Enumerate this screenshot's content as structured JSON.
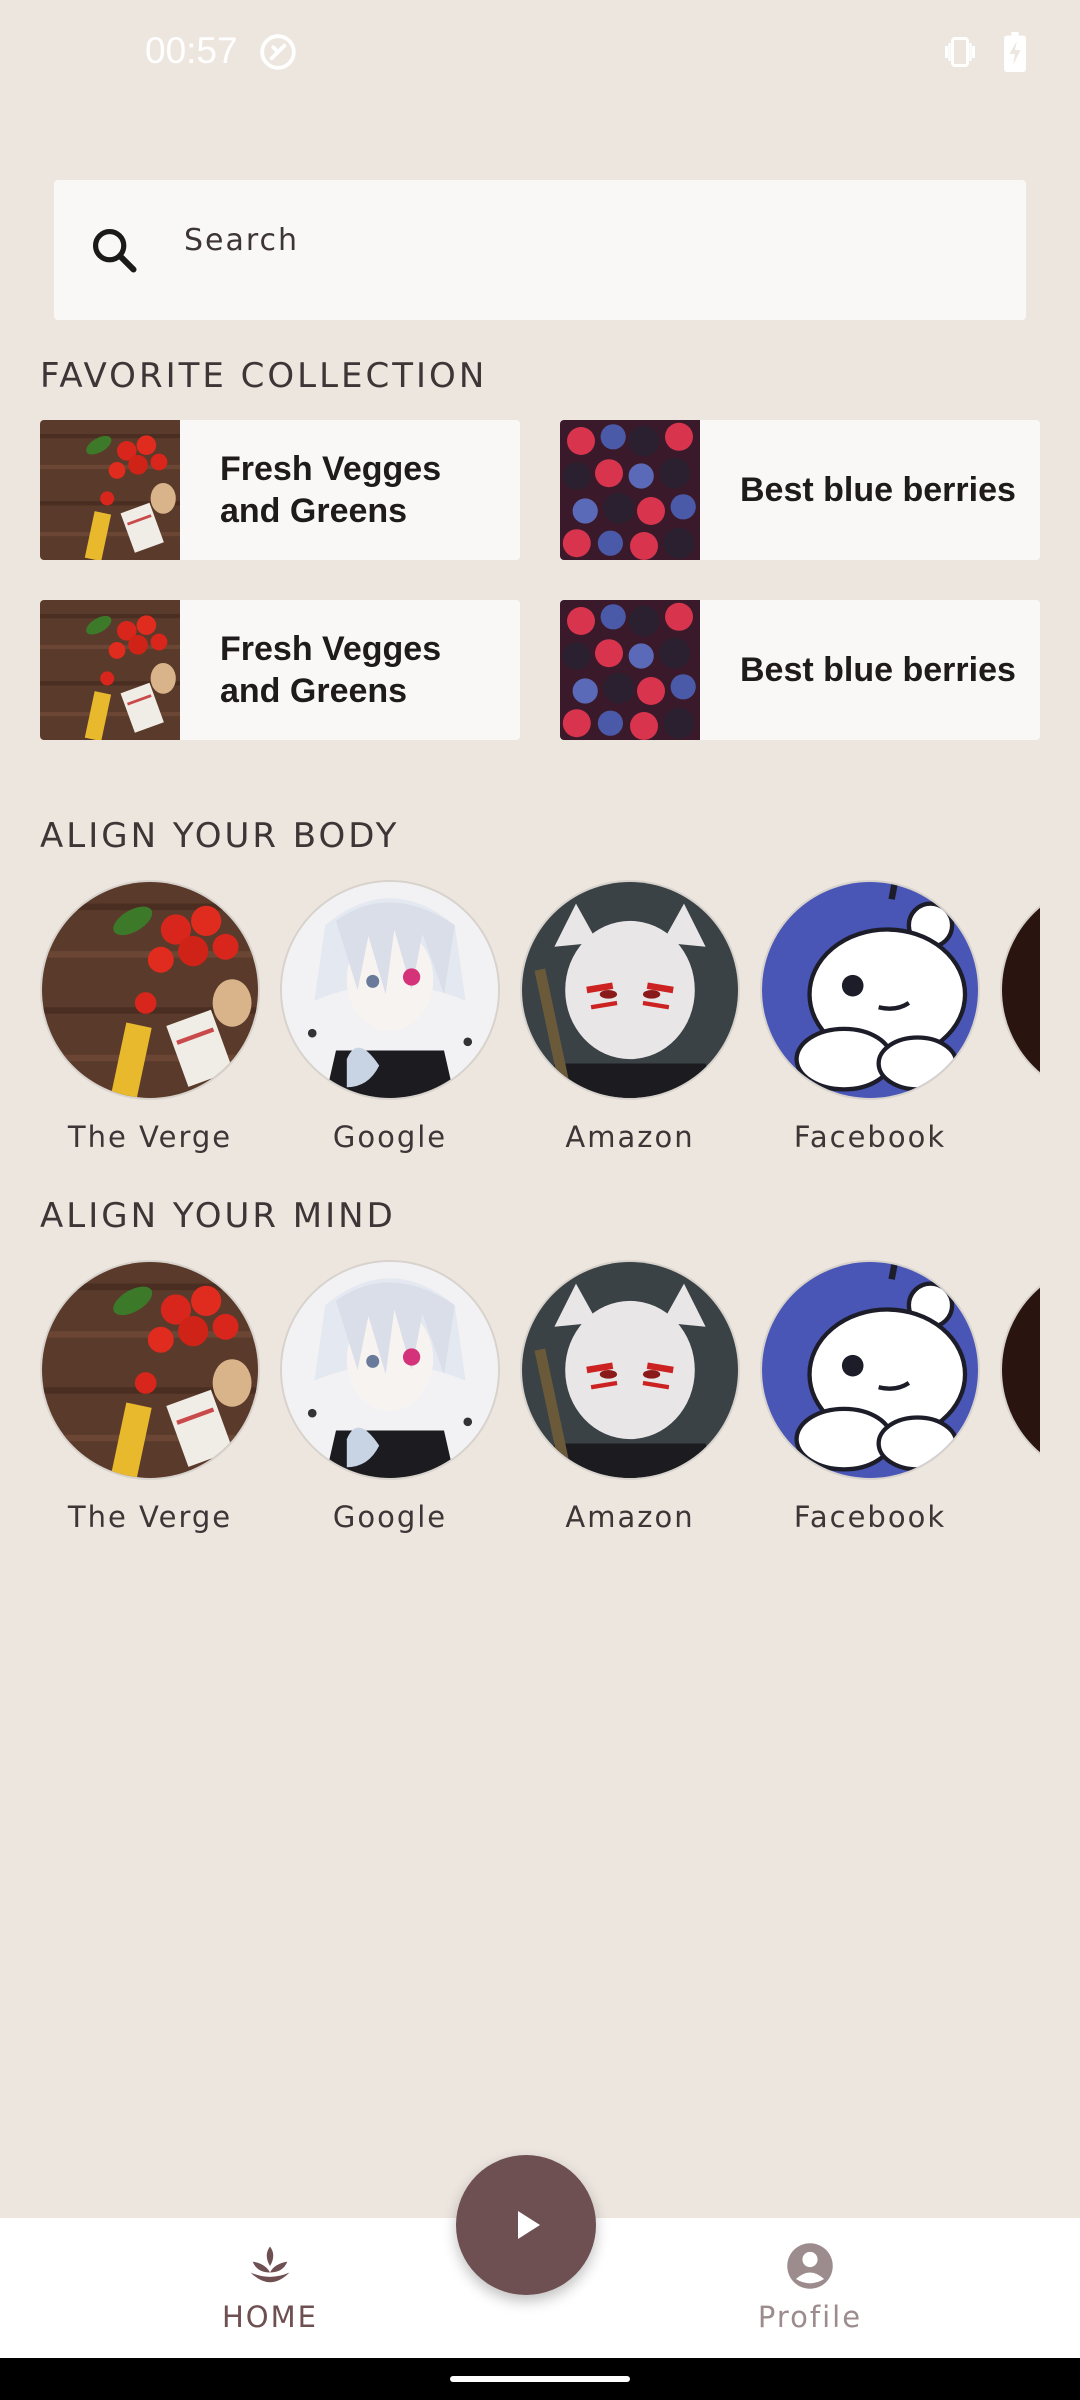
{
  "status_bar": {
    "time": "00:57"
  },
  "search": {
    "placeholder": "Search"
  },
  "favorite": {
    "title": "FAVORITE COLLECTION",
    "cards": [
      {
        "label": "Fresh Vegges and Greens",
        "image": "vegetables"
      },
      {
        "label": "Best blue berries",
        "image": "berries"
      },
      {
        "label": "Fresh Vegges and Greens",
        "image": "vegetables"
      },
      {
        "label": "Best blue berries",
        "image": "berries"
      }
    ]
  },
  "body_section": {
    "title": "ALIGN YOUR BODY",
    "items": [
      {
        "label": "The Verge",
        "image": "vegetables"
      },
      {
        "label": "Google",
        "image": "anime-white-hair"
      },
      {
        "label": "Amazon",
        "image": "anime-mask"
      },
      {
        "label": "Facebook",
        "image": "reddit-mascot"
      },
      {
        "label": "",
        "image": "fire"
      }
    ]
  },
  "mind_section": {
    "title": "ALIGN YOUR MIND",
    "items": [
      {
        "label": "The Verge",
        "image": "vegetables"
      },
      {
        "label": "Google",
        "image": "anime-white-hair"
      },
      {
        "label": "Amazon",
        "image": "anime-mask"
      },
      {
        "label": "Facebook",
        "image": "reddit-mascot"
      },
      {
        "label": "",
        "image": "fire"
      }
    ]
  },
  "bottom_nav": {
    "home_label": "HOME",
    "profile_label": "Profile",
    "active": "home"
  },
  "colors": {
    "background": "#EDE6DF",
    "surface": "#FAF8F6",
    "primary": "#6E4F52",
    "text": "#3D3536",
    "inactive": "#9C8C8D"
  }
}
